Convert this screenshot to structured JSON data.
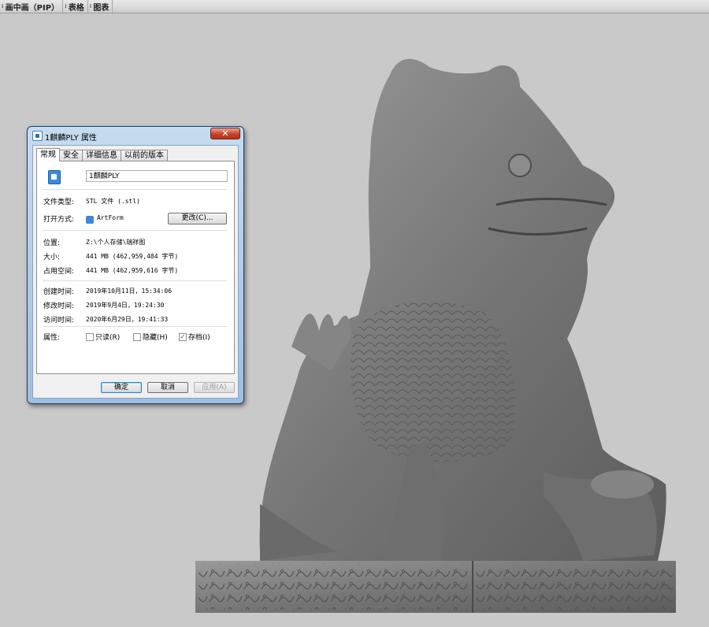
{
  "tabbar": {
    "tabs": [
      {
        "label": "画中画（PIP）"
      },
      {
        "label": "表格"
      },
      {
        "label": "图表"
      }
    ]
  },
  "dialog": {
    "title": "1麒麟PLY 属性",
    "close_glyph": "✕",
    "tabs": [
      "常规",
      "安全",
      "详细信息",
      "以前的版本"
    ],
    "active_tab": "常规",
    "file_name": "1麒麟PLY",
    "file_type_label": "文件类型:",
    "file_type_value": "STL 文件 (.stl)",
    "open_with_label": "打开方式:",
    "open_with_value": "ArtForm",
    "change_button": "更改(C)...",
    "location_label": "位置:",
    "location_value": "Z:\\个人存储\\瑞祥图",
    "size_label": "大小:",
    "size_value": "441 MB (462,959,484 字节)",
    "disk_size_label": "占用空间:",
    "disk_size_value": "441 MB (462,959,616 字节)",
    "created_label": "创建时间:",
    "created_value": "2019年10月11日，15:34:06",
    "modified_label": "修改时间:",
    "modified_value": "2019年9月4日，19:24:30",
    "accessed_label": "访问时间:",
    "accessed_value": "2020年6月29日，19:41:33",
    "attributes_label": "属性:",
    "attributes": [
      {
        "label": "只读(R)",
        "checked": false
      },
      {
        "label": "隐藏(H)",
        "checked": false
      },
      {
        "label": "存档(I)",
        "checked": true
      }
    ],
    "ok_button": "确定",
    "cancel_button": "取消",
    "apply_button": "应用(A)"
  },
  "colors": {
    "viewport_bg": "#c9c9c9",
    "model": "#7a7a7a",
    "dialog_frame": "#b4cde8"
  },
  "icons": {
    "file": "file-icon",
    "app": "artform-icon",
    "title": "properties-icon"
  }
}
